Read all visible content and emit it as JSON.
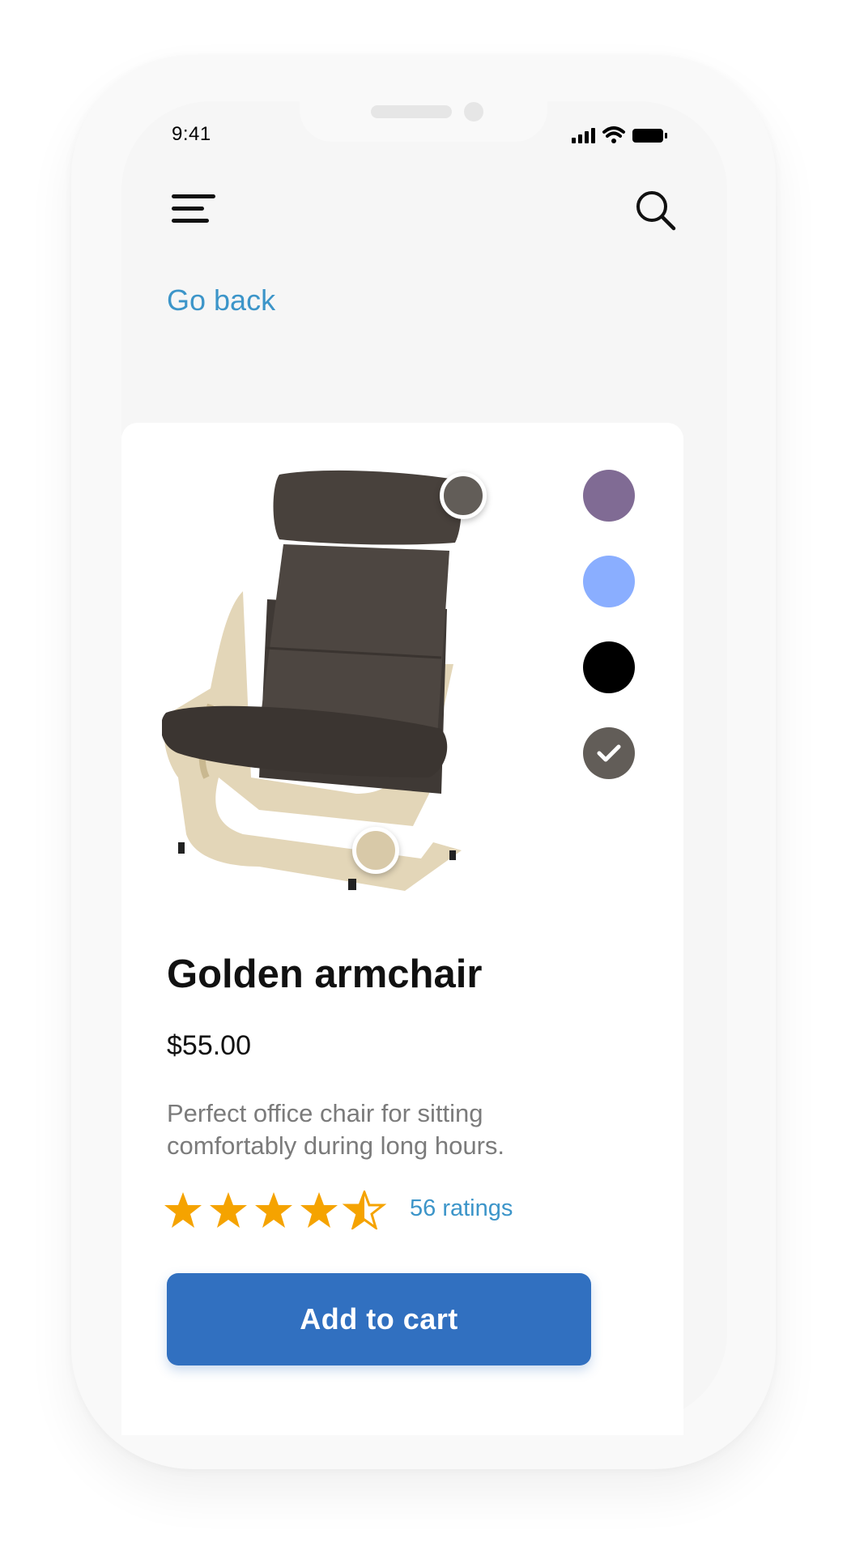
{
  "status_bar": {
    "time": "9:41"
  },
  "nav": {
    "back_label": "Go back"
  },
  "product": {
    "name": "Golden armchair",
    "price": "$55.00",
    "description": "Perfect office chair for sitting comfortably during long hours.",
    "rating": 4.5,
    "rating_max": 5,
    "ratings_label": "56 ratings",
    "add_to_cart_label": "Add to cart"
  },
  "colors": {
    "swatches": [
      "#806b94",
      "#8aaeff",
      "#000000",
      "#625d58"
    ],
    "selected_index": 3,
    "hotspot_cushion": "#625d58",
    "hotspot_frame": "#d8c9a8",
    "accent_link": "#3c95c9",
    "button": "#3170c0",
    "star": "#f5a300"
  },
  "icons": {
    "menu": "hamburger-menu-icon",
    "search": "search-icon",
    "signal": "cellular-signal-icon",
    "wifi": "wifi-icon",
    "battery": "battery-icon",
    "check": "check-icon",
    "star": "star-icon"
  }
}
